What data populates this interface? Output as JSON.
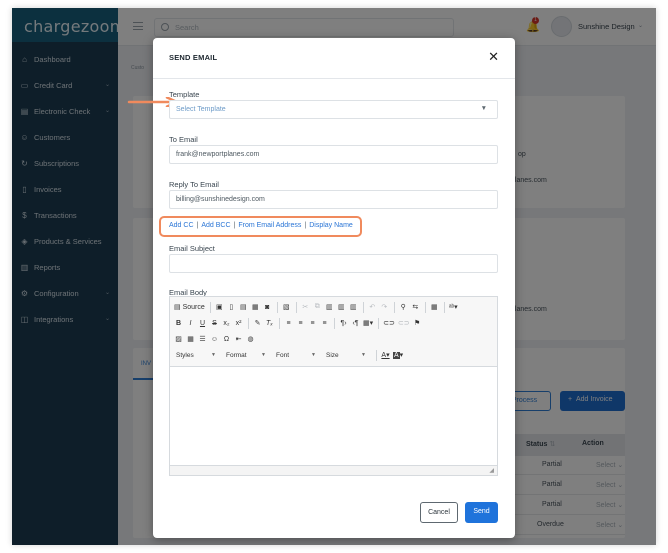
{
  "app": {
    "logo": "chargezoom",
    "search_placeholder": "Search",
    "notification_count": "1",
    "username": "Sunshine Design"
  },
  "sidebar": {
    "items": [
      {
        "label": "Dashboard",
        "icon": "home-icon",
        "has_submenu": false
      },
      {
        "label": "Credit Card",
        "icon": "credit-card-icon",
        "has_submenu": true
      },
      {
        "label": "Electronic Check",
        "icon": "check-icon",
        "has_submenu": true
      },
      {
        "label": "Customers",
        "icon": "users-icon",
        "has_submenu": false
      },
      {
        "label": "Subscriptions",
        "icon": "refresh-icon",
        "has_submenu": false
      },
      {
        "label": "Invoices",
        "icon": "invoice-icon",
        "has_submenu": false
      },
      {
        "label": "Transactions",
        "icon": "dollar-icon",
        "has_submenu": false
      },
      {
        "label": "Products & Services",
        "icon": "tag-icon",
        "has_submenu": false
      },
      {
        "label": "Reports",
        "icon": "bar-chart-icon",
        "has_submenu": false
      },
      {
        "label": "Configuration",
        "icon": "gear-icon",
        "has_submenu": true
      },
      {
        "label": "Integrations",
        "icon": "plug-icon",
        "has_submenu": true
      }
    ]
  },
  "background": {
    "breadcrumb": "Custo",
    "partial_texts": [
      "op",
      "planes.com",
      "planes.com"
    ],
    "tab": "INV",
    "process_button": "h Process",
    "add_invoice_button": "Add Invoice",
    "table_headers": [
      "Status",
      "Action"
    ],
    "rows": [
      {
        "status": "Partial",
        "action": "Select"
      },
      {
        "status": "Partial",
        "action": "Select"
      },
      {
        "status": "Partial",
        "action": "Select"
      },
      {
        "status": "Overdue",
        "action": "Select"
      }
    ]
  },
  "modal": {
    "title": "SEND EMAIL",
    "template_label": "Template",
    "template_value": "Select Template",
    "to_email_label": "To Email",
    "to_email_value": "frank@newportplanes.com",
    "reply_to_label": "Reply To Email",
    "reply_to_value": "billing@sunshinedesign.com",
    "links": [
      "Add CC",
      "Add BCC",
      "From Email Address",
      "Display Name"
    ],
    "link_separator": "|",
    "subject_label": "Email Subject",
    "subject_value": "",
    "body_label": "Email Body",
    "editor": {
      "source_label": "Source",
      "style_combos": [
        "Styles",
        "Format",
        "Font",
        "Size"
      ]
    },
    "cancel_label": "Cancel",
    "send_label": "Send"
  },
  "colors": {
    "sidebar": "#1d3d52",
    "logo_bar": "#18607f",
    "primary": "#1f73db",
    "highlight": "#f08a5d",
    "link": "#2a75d6"
  }
}
